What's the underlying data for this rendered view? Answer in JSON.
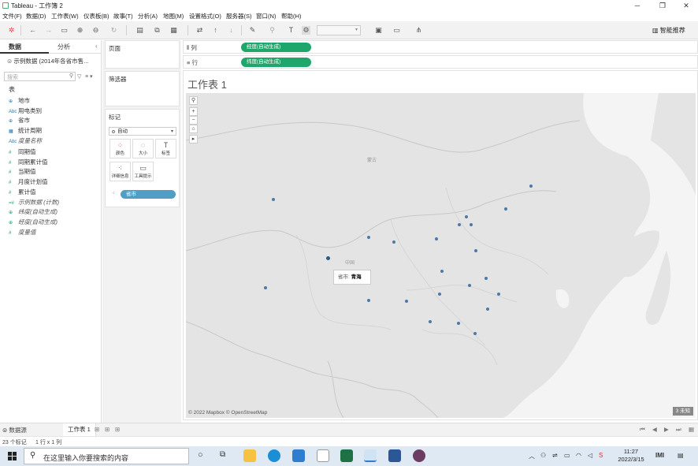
{
  "window": {
    "title": "Tableau - 工作簿 2"
  },
  "menu": [
    "文件(F)",
    "数据(D)",
    "工作表(W)",
    "仪表板(B)",
    "故事(T)",
    "分析(A)",
    "地图(M)",
    "设置格式(O)",
    "服务器(S)",
    "窗口(N)",
    "帮助(H)"
  ],
  "toolbar": {
    "smart_label": "智能推荐"
  },
  "left_pane": {
    "tab_data": "数据",
    "tab_analysis": "分析",
    "datasource": "示例数据 (2014年各省市售...",
    "search_placeholder": "搜索",
    "table_header": "表",
    "dimensions": [
      "地市",
      "用电类别",
      "省市",
      "统计周期",
      "度量名称"
    ],
    "measures": [
      "同期值",
      "同期累计值",
      "当期值",
      "月度计划值",
      "累计值",
      "示例数据 (计数)",
      "纬度(自动生成)",
      "经度(自动生成)",
      "度量值"
    ]
  },
  "shelves": {
    "pages": "页面",
    "filters": "筛选器",
    "marks": "标记",
    "marks_type": "自动",
    "mark_buttons": [
      "颜色",
      "大小",
      "标签",
      "详细信息",
      "工具提示"
    ],
    "detail_pill": "省市",
    "columns_label": "列",
    "columns_pill": "经度(自动生成)",
    "rows_label": "行",
    "rows_pill": "纬度(自动生成)"
  },
  "viz": {
    "sheet_title": "工作表 1",
    "copyright": "© 2022 Mapbox © OpenStreetMap",
    "unknown_badge": "3 未知",
    "tooltip_label": "省市:",
    "tooltip_value": "青海",
    "map_labels": [
      "蒙古",
      "中国"
    ]
  },
  "bottom_tabs": {
    "datasource": "数据源",
    "sheet": "工作表 1"
  },
  "status": {
    "marks": "23 个标记",
    "rows_cols": "1 行 x 1 列"
  },
  "taskbar": {
    "search_placeholder": "在这里输入你要搜索的内容",
    "time": "11:27",
    "date": "2022/3/15"
  },
  "colors": {
    "accent_green": "#1fa76b",
    "accent_blue": "#4f9ec4",
    "point": "#4e79a7"
  }
}
